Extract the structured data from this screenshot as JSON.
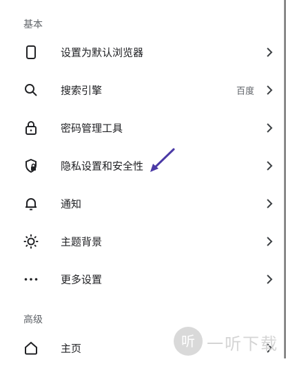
{
  "sections": {
    "basic_label": "基本",
    "advanced_label": "高级"
  },
  "items": [
    {
      "label": "设置为默认浏览器",
      "icon": "phone-icon"
    },
    {
      "label": "搜索引擎",
      "value": "百度",
      "icon": "search-icon"
    },
    {
      "label": "密码管理工具",
      "icon": "lock-icon"
    },
    {
      "label": "隐私设置和安全性",
      "icon": "shield-lock-icon"
    },
    {
      "label": "通知",
      "icon": "bell-icon"
    },
    {
      "label": "主题背景",
      "icon": "sun-icon"
    },
    {
      "label": "更多设置",
      "icon": "more-dots-icon"
    },
    {
      "label": "主页",
      "icon": "home-icon"
    }
  ],
  "watermark": {
    "logo_char": "听",
    "text": "一听下载"
  },
  "colors": {
    "text": "#202124",
    "secondary": "#5f6368",
    "annotation_arrow": "#4b3aa6"
  }
}
